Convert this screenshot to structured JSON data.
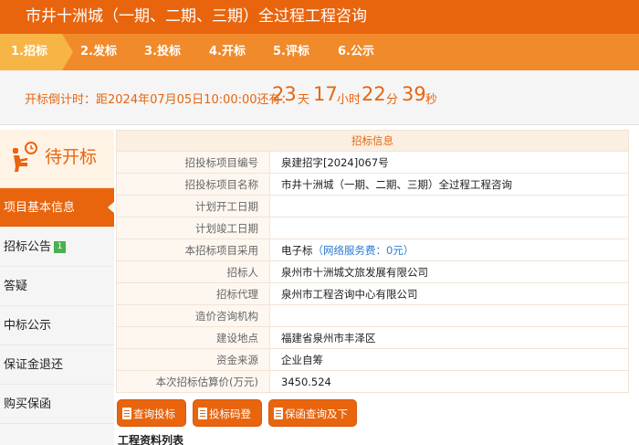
{
  "header": {
    "title": "市井十洲城（一期、二期、三期）全过程工程咨询"
  },
  "steps": [
    "1.招标",
    "2.发标",
    "3.投标",
    "4.开标",
    "5.评标",
    "6.公示"
  ],
  "countdown": {
    "prefix": "开标倒计时：距2024年07月05日10:00:00还有：",
    "days": "23",
    "days_unit": "天",
    "hours": "17",
    "hours_unit": "小时",
    "minutes": "22",
    "minutes_unit": "分",
    "seconds": "39",
    "seconds_unit": "秒"
  },
  "status": {
    "label": "待开标",
    "icon": "person-clock-icon"
  },
  "sidebar": {
    "items": [
      {
        "label": "项目基本信息"
      },
      {
        "label": "招标公告",
        "badge": "1"
      },
      {
        "label": "答疑"
      },
      {
        "label": "中标公示"
      },
      {
        "label": "保证金退还"
      },
      {
        "label": "购买保函"
      }
    ]
  },
  "info": {
    "heading": "招标信息",
    "rows": [
      {
        "label": "招投标项目编号",
        "value": "泉建招字[2024]067号"
      },
      {
        "label": "招投标项目名称",
        "value": "市井十洲城（一期、二期、三期）全过程工程咨询"
      },
      {
        "label": "计划开工日期",
        "value": ""
      },
      {
        "label": "计划竣工日期",
        "value": ""
      },
      {
        "label": "本招标项目采用",
        "value": "电子标",
        "note": "（网络服务费：0元）"
      },
      {
        "label": "招标人",
        "value": "泉州市十洲城文旅发展有限公司"
      },
      {
        "label": "招标代理",
        "value": "泉州市工程咨询中心有限公司"
      },
      {
        "label": "造价咨询机构",
        "value": ""
      },
      {
        "label": "建设地点",
        "value": "福建省泉州市丰泽区"
      },
      {
        "label": "资金来源",
        "value": "企业自筹"
      },
      {
        "label": "本次招标估算价(万元)",
        "value": "3450.524"
      }
    ]
  },
  "buttons": {
    "query_code": "查询投标码",
    "login_code": "投标码登录",
    "guarantee": "保函查询及下载"
  },
  "materials": {
    "title": "工程资料列表"
  },
  "colors": {
    "brand": "#e8650e",
    "step_bar": "#f08a2a",
    "step_active": "#f6b545",
    "badge": "#4caf50",
    "link": "#2a7ad4"
  }
}
